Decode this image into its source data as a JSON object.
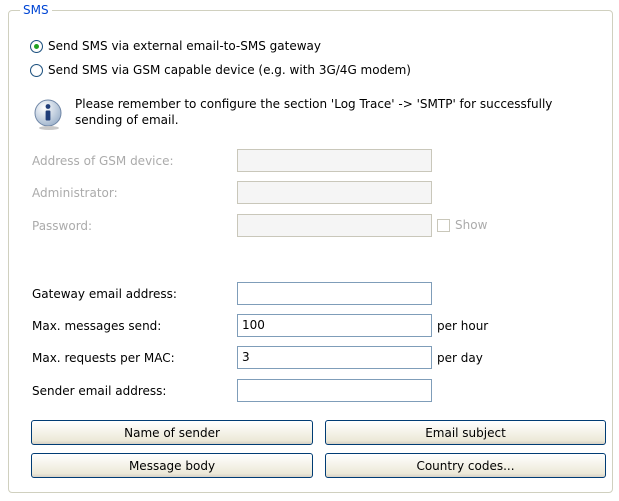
{
  "group_title": "SMS",
  "radios": [
    {
      "label": "Send SMS via external email-to-SMS gateway",
      "checked": true
    },
    {
      "label": "Send SMS via GSM capable device (e.g. with 3G/4G modem)",
      "checked": false
    }
  ],
  "info_text": "Please remember to configure the section 'Log  Trace' -> 'SMTP' for successfully sending of email.",
  "gsm": {
    "address_label": "Address of GSM device:",
    "address_value": "",
    "admin_label": "Administrator:",
    "admin_value": "",
    "password_label": "Password:",
    "password_value": "",
    "show_label": "Show"
  },
  "gateway": {
    "email_label": "Gateway email address:",
    "email_value": "",
    "max_send_label": "Max. messages send:",
    "max_send_value": "100",
    "max_send_unit": "per hour",
    "max_req_label": "Max. requests per MAC:",
    "max_req_value": "3",
    "max_req_unit": "per day",
    "sender_label": "Sender email address:",
    "sender_value": ""
  },
  "buttons": {
    "name_of_sender": "Name of sender",
    "email_subject": "Email subject",
    "message_body": "Message body",
    "country_codes": "Country codes..."
  }
}
